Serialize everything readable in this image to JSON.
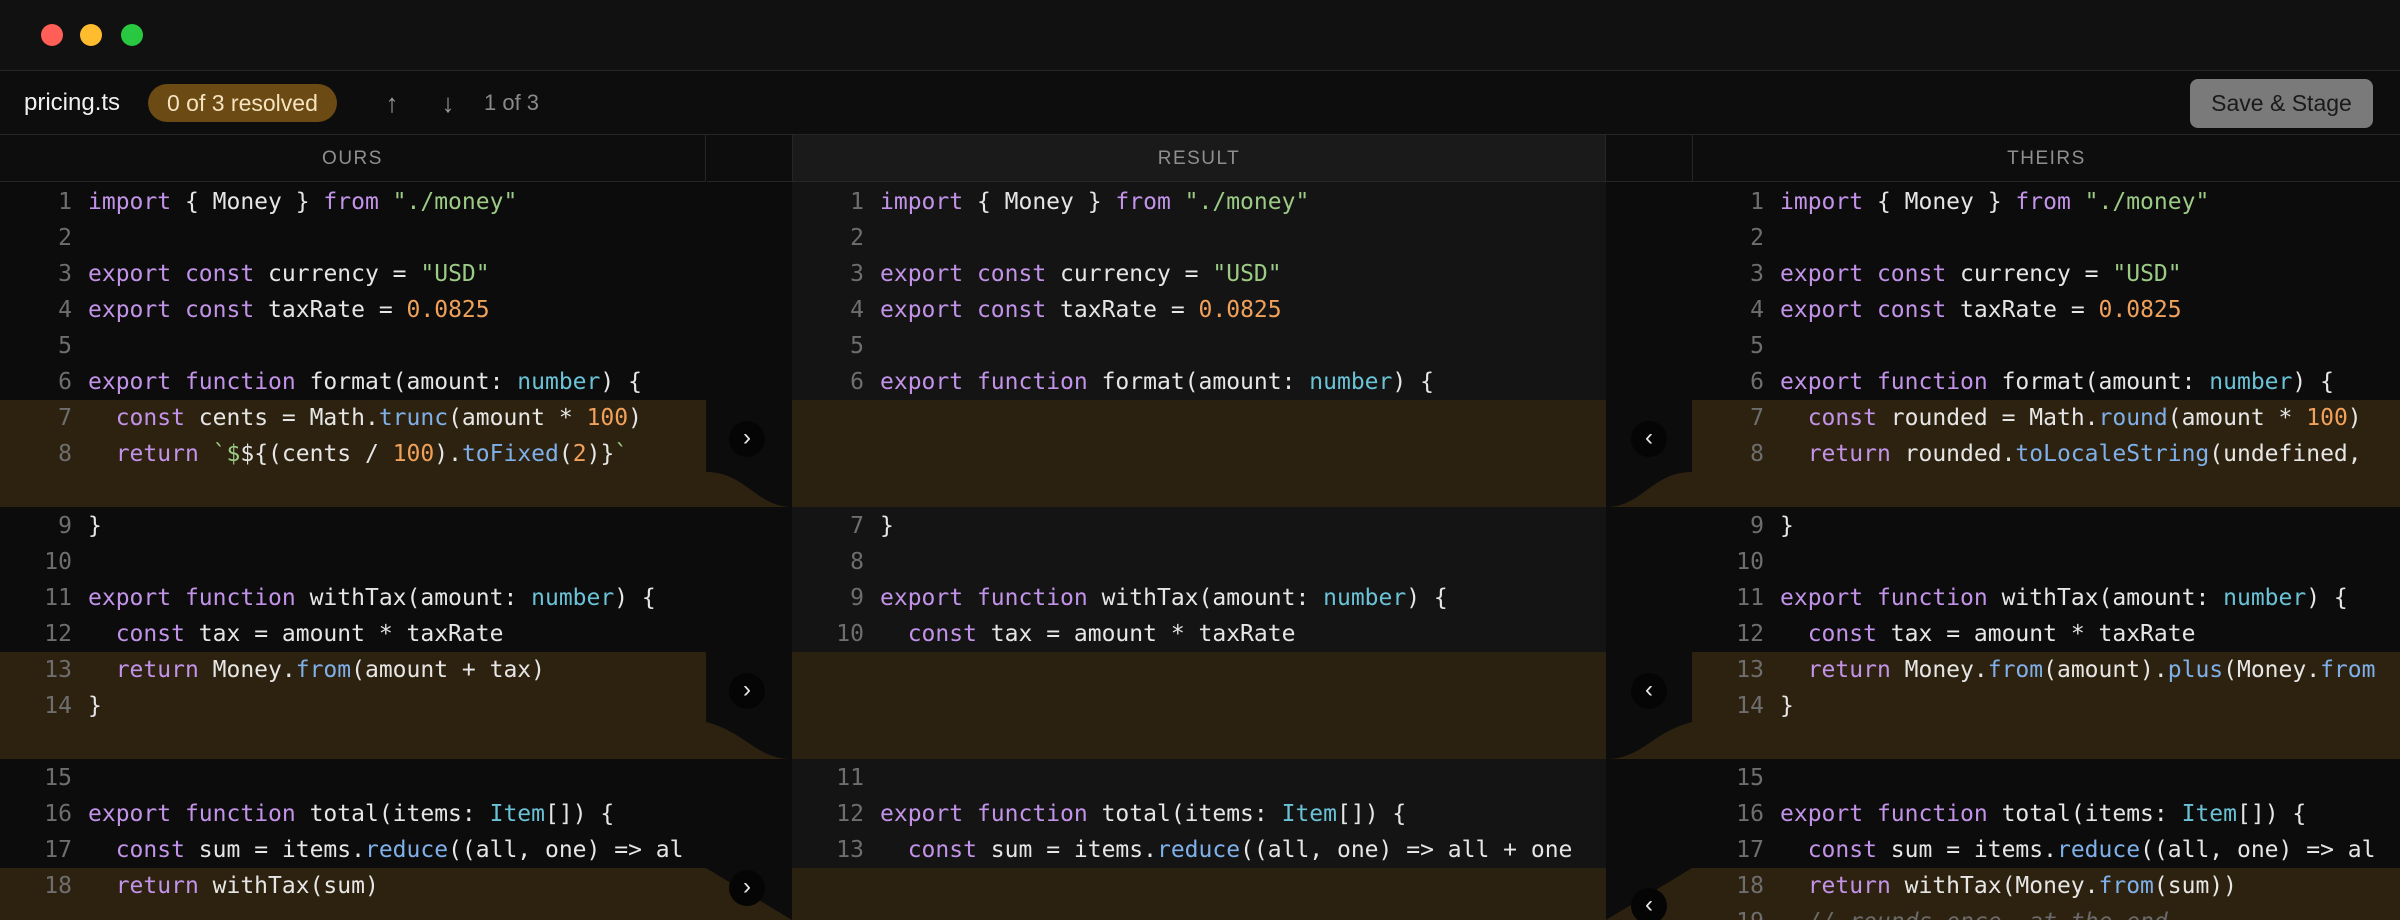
{
  "toolbar": {
    "filename": "pricing.ts",
    "resolved_badge": "0 of 3 resolved",
    "prev_conflict_icon": "arrow-up-icon",
    "next_conflict_icon": "arrow-down-icon",
    "counter": "1 of 3",
    "save_label": "Save & Stage"
  },
  "columns": {
    "ours": "OURS",
    "result": "RESULT",
    "theirs": "THEIRS"
  },
  "colors": {
    "conflict_bg": "#2d220f",
    "badge_bg": "#6b4a13",
    "keyword": "#c293e8",
    "string": "#9ccb86",
    "number": "#f0a15a",
    "type": "#6ac2d6",
    "function": "#7fb0ea"
  },
  "actions": {
    "accept_ours_icon": "›",
    "accept_theirs_icon": "‹"
  },
  "panes": {
    "ours": [
      {
        "n": "1",
        "t": [
          [
            "kw",
            "import"
          ],
          [
            "p",
            " { Money } "
          ],
          [
            "kw",
            "from"
          ],
          [
            "p",
            " "
          ],
          [
            "str",
            "\"./money\""
          ]
        ]
      },
      {
        "n": "2",
        "t": []
      },
      {
        "n": "3",
        "t": [
          [
            "kw",
            "export"
          ],
          [
            "p",
            " "
          ],
          [
            "kw",
            "const"
          ],
          [
            "p",
            " currency = "
          ],
          [
            "str",
            "\"USD\""
          ]
        ]
      },
      {
        "n": "4",
        "t": [
          [
            "kw",
            "export"
          ],
          [
            "p",
            " "
          ],
          [
            "kw",
            "const"
          ],
          [
            "p",
            " taxRate = "
          ],
          [
            "num",
            "0.0825"
          ]
        ]
      },
      {
        "n": "5",
        "t": []
      },
      {
        "n": "6",
        "t": [
          [
            "kw",
            "export"
          ],
          [
            "p",
            " "
          ],
          [
            "kw",
            "function"
          ],
          [
            "p",
            " format(amount: "
          ],
          [
            "type",
            "number"
          ],
          [
            "p",
            ") {"
          ]
        ]
      },
      {
        "n": "7",
        "t": [
          [
            "p",
            "  "
          ],
          [
            "kw",
            "const"
          ],
          [
            "p",
            " cents = Math."
          ],
          [
            "fn",
            "trunc"
          ],
          [
            "p",
            "(amount * "
          ],
          [
            "num",
            "100"
          ],
          [
            "p",
            ")"
          ]
        ]
      },
      {
        "n": "8",
        "t": [
          [
            "p",
            "  "
          ],
          [
            "kw",
            "return"
          ],
          [
            "p",
            " "
          ],
          [
            "str",
            "`$"
          ],
          [
            "p",
            "${(cents / "
          ],
          [
            "num",
            "100"
          ],
          [
            "p",
            ")."
          ],
          [
            "fn",
            "toFixed"
          ],
          [
            "p",
            "("
          ],
          [
            "num",
            "2"
          ],
          [
            "p",
            ")}"
          ],
          [
            "str",
            "`"
          ]
        ]
      },
      {
        "n": "9",
        "t": [
          [
            "p",
            "}"
          ]
        ]
      },
      {
        "n": "10",
        "t": []
      },
      {
        "n": "11",
        "t": [
          [
            "kw",
            "export"
          ],
          [
            "p",
            " "
          ],
          [
            "kw",
            "function"
          ],
          [
            "p",
            " withTax(amount: "
          ],
          [
            "type",
            "number"
          ],
          [
            "p",
            ") {"
          ]
        ]
      },
      {
        "n": "12",
        "t": [
          [
            "p",
            "  "
          ],
          [
            "kw",
            "const"
          ],
          [
            "p",
            " tax = amount * taxRate"
          ]
        ]
      },
      {
        "n": "13",
        "t": [
          [
            "p",
            "  "
          ],
          [
            "kw",
            "return"
          ],
          [
            "p",
            " Money."
          ],
          [
            "fn",
            "from"
          ],
          [
            "p",
            "(amount + tax)"
          ]
        ]
      },
      {
        "n": "14",
        "t": [
          [
            "p",
            "}"
          ]
        ]
      },
      {
        "n": "15",
        "t": []
      },
      {
        "n": "16",
        "t": [
          [
            "kw",
            "export"
          ],
          [
            "p",
            " "
          ],
          [
            "kw",
            "function"
          ],
          [
            "p",
            " total(items: "
          ],
          [
            "type",
            "Item"
          ],
          [
            "p",
            "[]) {"
          ]
        ]
      },
      {
        "n": "17",
        "t": [
          [
            "p",
            "  "
          ],
          [
            "kw",
            "const"
          ],
          [
            "p",
            " sum = items."
          ],
          [
            "fn",
            "reduce"
          ],
          [
            "p",
            "((all, one) => al"
          ]
        ]
      },
      {
        "n": "18",
        "t": [
          [
            "p",
            "  "
          ],
          [
            "kw",
            "return"
          ],
          [
            "p",
            " withTax(sum)"
          ]
        ]
      }
    ],
    "result": [
      {
        "n": "1",
        "t": [
          [
            "kw",
            "import"
          ],
          [
            "p",
            " { Money } "
          ],
          [
            "kw",
            "from"
          ],
          [
            "p",
            " "
          ],
          [
            "str",
            "\"./money\""
          ]
        ]
      },
      {
        "n": "2",
        "t": []
      },
      {
        "n": "3",
        "t": [
          [
            "kw",
            "export"
          ],
          [
            "p",
            " "
          ],
          [
            "kw",
            "const"
          ],
          [
            "p",
            " currency = "
          ],
          [
            "str",
            "\"USD\""
          ]
        ]
      },
      {
        "n": "4",
        "t": [
          [
            "kw",
            "export"
          ],
          [
            "p",
            " "
          ],
          [
            "kw",
            "const"
          ],
          [
            "p",
            " taxRate = "
          ],
          [
            "num",
            "0.0825"
          ]
        ]
      },
      {
        "n": "5",
        "t": []
      },
      {
        "n": "6",
        "t": [
          [
            "kw",
            "export"
          ],
          [
            "p",
            " "
          ],
          [
            "kw",
            "function"
          ],
          [
            "p",
            " format(amount: "
          ],
          [
            "type",
            "number"
          ],
          [
            "p",
            ") {"
          ]
        ]
      },
      {
        "n": "7",
        "t": [
          [
            "p",
            "}"
          ]
        ]
      },
      {
        "n": "8",
        "t": []
      },
      {
        "n": "9",
        "t": [
          [
            "kw",
            "export"
          ],
          [
            "p",
            " "
          ],
          [
            "kw",
            "function"
          ],
          [
            "p",
            " withTax(amount: "
          ],
          [
            "type",
            "number"
          ],
          [
            "p",
            ") {"
          ]
        ]
      },
      {
        "n": "10",
        "t": [
          [
            "p",
            "  "
          ],
          [
            "kw",
            "const"
          ],
          [
            "p",
            " tax = amount * taxRate"
          ]
        ]
      },
      {
        "n": "11",
        "t": []
      },
      {
        "n": "12",
        "t": [
          [
            "kw",
            "export"
          ],
          [
            "p",
            " "
          ],
          [
            "kw",
            "function"
          ],
          [
            "p",
            " total(items: "
          ],
          [
            "type",
            "Item"
          ],
          [
            "p",
            "[]) {"
          ]
        ]
      },
      {
        "n": "13",
        "t": [
          [
            "p",
            "  "
          ],
          [
            "kw",
            "const"
          ],
          [
            "p",
            " sum = items."
          ],
          [
            "fn",
            "reduce"
          ],
          [
            "p",
            "((all, one) => all + one"
          ]
        ]
      }
    ],
    "theirs": [
      {
        "n": "1",
        "t": [
          [
            "kw",
            "import"
          ],
          [
            "p",
            " { Money } "
          ],
          [
            "kw",
            "from"
          ],
          [
            "p",
            " "
          ],
          [
            "str",
            "\"./money\""
          ]
        ]
      },
      {
        "n": "2",
        "t": []
      },
      {
        "n": "3",
        "t": [
          [
            "kw",
            "export"
          ],
          [
            "p",
            " "
          ],
          [
            "kw",
            "const"
          ],
          [
            "p",
            " currency = "
          ],
          [
            "str",
            "\"USD\""
          ]
        ]
      },
      {
        "n": "4",
        "t": [
          [
            "kw",
            "export"
          ],
          [
            "p",
            " "
          ],
          [
            "kw",
            "const"
          ],
          [
            "p",
            " taxRate = "
          ],
          [
            "num",
            "0.0825"
          ]
        ]
      },
      {
        "n": "5",
        "t": []
      },
      {
        "n": "6",
        "t": [
          [
            "kw",
            "export"
          ],
          [
            "p",
            " "
          ],
          [
            "kw",
            "function"
          ],
          [
            "p",
            " format(amount: "
          ],
          [
            "type",
            "number"
          ],
          [
            "p",
            ") {"
          ]
        ]
      },
      {
        "n": "7",
        "t": [
          [
            "p",
            "  "
          ],
          [
            "kw",
            "const"
          ],
          [
            "p",
            " rounded = Math."
          ],
          [
            "fn",
            "round"
          ],
          [
            "p",
            "(amount * "
          ],
          [
            "num",
            "100"
          ],
          [
            "p",
            ")"
          ]
        ]
      },
      {
        "n": "8",
        "t": [
          [
            "p",
            "  "
          ],
          [
            "kw",
            "return"
          ],
          [
            "p",
            " rounded."
          ],
          [
            "fn",
            "toLocaleString"
          ],
          [
            "p",
            "(undefined,"
          ]
        ]
      },
      {
        "n": "9",
        "t": [
          [
            "p",
            "}"
          ]
        ]
      },
      {
        "n": "10",
        "t": []
      },
      {
        "n": "11",
        "t": [
          [
            "kw",
            "export"
          ],
          [
            "p",
            " "
          ],
          [
            "kw",
            "function"
          ],
          [
            "p",
            " withTax(amount: "
          ],
          [
            "type",
            "number"
          ],
          [
            "p",
            ") {"
          ]
        ]
      },
      {
        "n": "12",
        "t": [
          [
            "p",
            "  "
          ],
          [
            "kw",
            "const"
          ],
          [
            "p",
            " tax = amount * taxRate"
          ]
        ]
      },
      {
        "n": "13",
        "t": [
          [
            "p",
            "  "
          ],
          [
            "kw",
            "return"
          ],
          [
            "p",
            " Money."
          ],
          [
            "fn",
            "from"
          ],
          [
            "p",
            "(amount)."
          ],
          [
            "fn",
            "plus"
          ],
          [
            "p",
            "(Money."
          ],
          [
            "fn",
            "from"
          ]
        ]
      },
      {
        "n": "14",
        "t": [
          [
            "p",
            "}"
          ]
        ]
      },
      {
        "n": "15",
        "t": []
      },
      {
        "n": "16",
        "t": [
          [
            "kw",
            "export"
          ],
          [
            "p",
            " "
          ],
          [
            "kw",
            "function"
          ],
          [
            "p",
            " total(items: "
          ],
          [
            "type",
            "Item"
          ],
          [
            "p",
            "[]) {"
          ]
        ]
      },
      {
        "n": "17",
        "t": [
          [
            "p",
            "  "
          ],
          [
            "kw",
            "const"
          ],
          [
            "p",
            " sum = items."
          ],
          [
            "fn",
            "reduce"
          ],
          [
            "p",
            "((all, one) => al"
          ]
        ]
      },
      {
        "n": "18",
        "t": [
          [
            "p",
            "  "
          ],
          [
            "kw",
            "return"
          ],
          [
            "p",
            " withTax(Money."
          ],
          [
            "fn",
            "from"
          ],
          [
            "p",
            "(sum))"
          ]
        ]
      },
      {
        "n": "19",
        "t": [
          [
            "cm",
            "  // rounds once, at the end"
          ]
        ]
      }
    ]
  }
}
